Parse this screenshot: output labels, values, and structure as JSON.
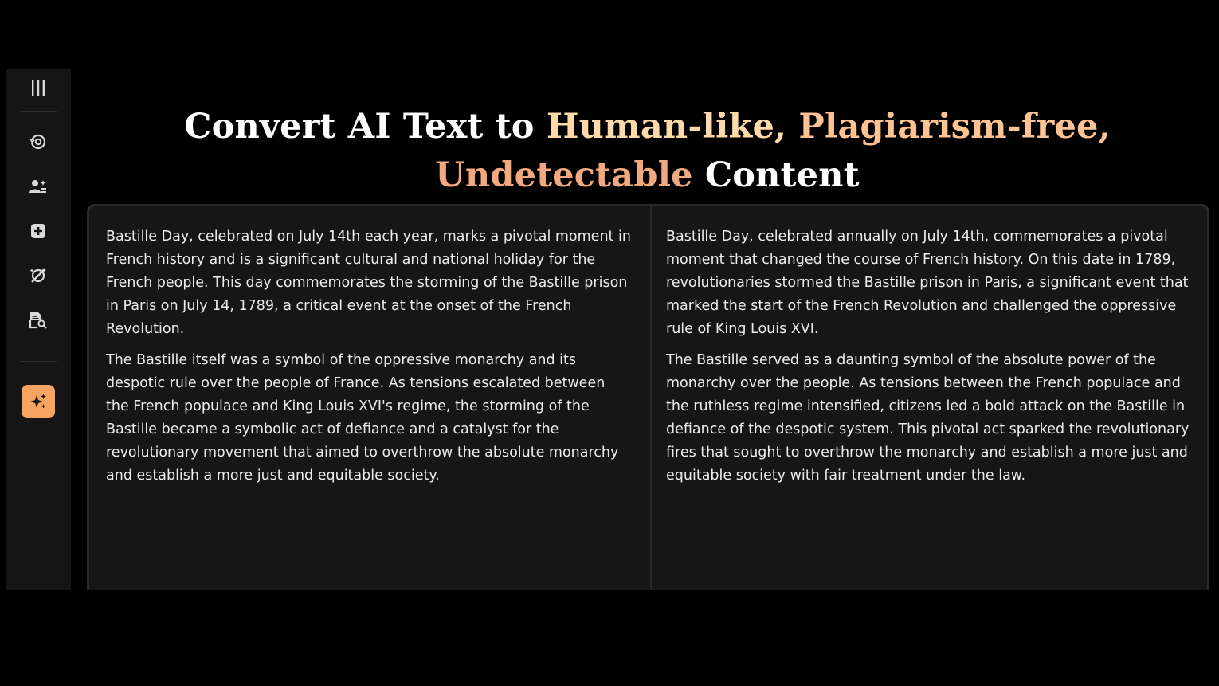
{
  "sidebar": {
    "items": [
      {
        "icon": "menu-icon"
      },
      {
        "icon": "rewrite-cycle-icon"
      },
      {
        "icon": "ai-humanize-icon"
      },
      {
        "icon": "add-square-icon"
      },
      {
        "icon": "magic-tools-icon"
      },
      {
        "icon": "document-search-icon"
      },
      {
        "icon": "sparkles-icon",
        "active": true
      }
    ],
    "accent_color": "#f7a462"
  },
  "headline": {
    "part1": "Convert AI Text to ",
    "highlight1": "Human-like,",
    "space1": " ",
    "highlight2": "Plagiarism-free,",
    "highlight3": "Undetectable",
    "part2": " Content"
  },
  "input_panel": {
    "paragraphs": [
      "Bastille Day, celebrated on July 14th each year, marks a pivotal moment in French history and is a significant cultural and national holiday for the French people. This day commemorates the storming of the Bastille prison in Paris on July 14, 1789, a critical event at the onset of the French Revolution.",
      "The Bastille itself was a symbol of the oppressive monarchy and its despotic rule over the people of France. As tensions escalated between the French populace and King Louis XVI's regime, the storming of the Bastille became a symbolic act of defiance and a catalyst for the revolutionary movement that aimed to overthrow the absolute monarchy and establish a more just and equitable society."
    ]
  },
  "output_panel": {
    "paragraphs": [
      "Bastille Day, celebrated annually on July 14th, commemorates a pivotal moment that changed the course of French history. On this date in 1789, revolutionaries stormed the Bastille prison in Paris, a significant event that marked the start of the French Revolution and challenged the oppressive rule of King Louis XVI.",
      "The Bastille served as a daunting symbol of the absolute power of the monarchy over the people. As tensions between the French populace and the ruthless regime intensified, citizens led a bold attack on the Bastille in defiance of the despotic system. This pivotal act sparked the revolutionary fires that sought to overthrow the monarchy and establish a more just and equitable society with fair treatment under the law."
    ]
  }
}
